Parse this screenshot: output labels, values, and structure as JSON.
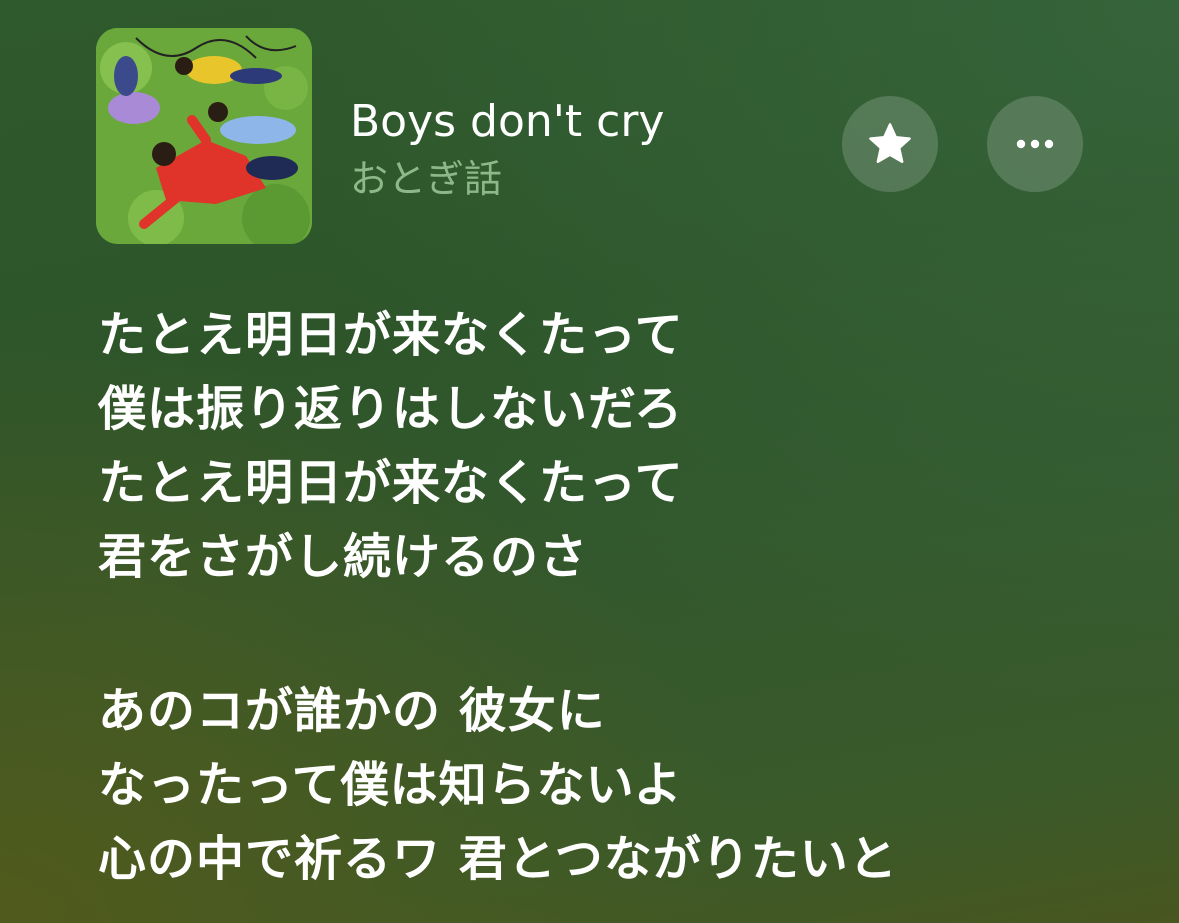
{
  "now_playing": {
    "song_title": "Boys don't cry",
    "artist": "おとぎ話",
    "artwork_icon": "album-artwork",
    "favorite_icon": "star-icon",
    "more_icon": "ellipsis-icon"
  },
  "lyrics": {
    "stanza1": [
      "たとえ明日が来なくたって",
      "僕は振り返りはしないだろ",
      "たとえ明日が来なくたって",
      "君をさがし続けるのさ"
    ],
    "stanza2": [
      "あのコが誰かの 彼女に",
      "なったって僕は知らないよ",
      "心の中で祈るワ 君とつながりたいと"
    ]
  },
  "colors": {
    "background": "#2f5a2d",
    "artist_text": "#8fb88a",
    "lyric_text": "#ffffff"
  }
}
